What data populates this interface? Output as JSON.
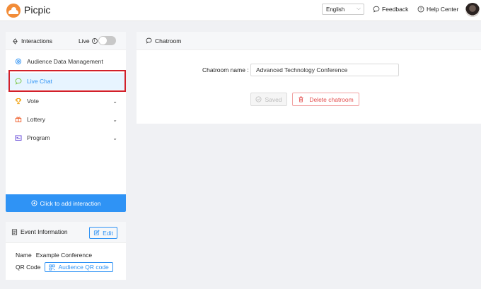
{
  "header": {
    "brand": "Picpic",
    "language": "English",
    "feedback": "Feedback",
    "help": "Help Center"
  },
  "sidebar": {
    "title": "Interactions",
    "live_label": "Live",
    "items": [
      {
        "label": "Audience Data Management",
        "icon": "gear-icon"
      },
      {
        "label": "Live Chat",
        "icon": "chat-icon"
      },
      {
        "label": "Vote",
        "icon": "trophy-icon"
      },
      {
        "label": "Lottery",
        "icon": "gift-icon"
      },
      {
        "label": "Program",
        "icon": "calendar-icon"
      }
    ],
    "add_button": "Click to add interaction"
  },
  "event": {
    "title": "Event Information",
    "edit_label": "Edit",
    "name_label": "Name",
    "name_value": "Example Conference",
    "qr_label": "QR Code",
    "qr_button": "Audience QR code"
  },
  "main": {
    "title": "Chatroom",
    "field_label": "Chatroom name :",
    "field_value": "Advanced Technology Conference",
    "saved_label": "Saved",
    "delete_label": "Delete chatroom"
  },
  "colors": {
    "accent": "#2f93f5",
    "danger": "#e34d4d",
    "highlight": "#d2202a"
  }
}
